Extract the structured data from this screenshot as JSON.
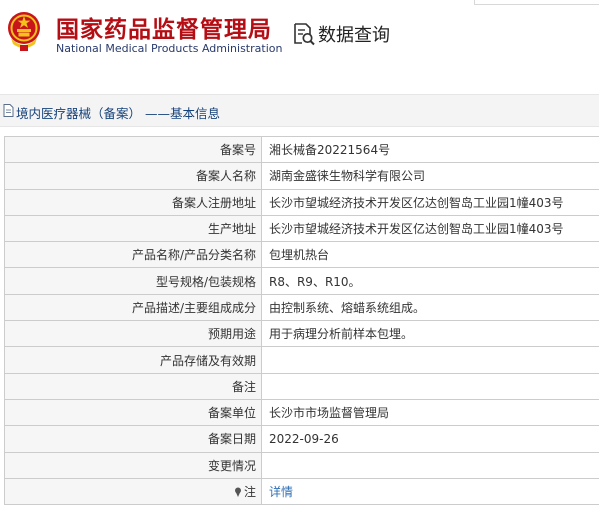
{
  "header": {
    "title_cn": "国家药品监督管理局",
    "title_en": "National Medical Products Administration",
    "query_label": "数据查询"
  },
  "section": {
    "title": "境内医疗器械（备案） ——基本信息"
  },
  "icons": {
    "emblem": "national-emblem-icon",
    "query": "document-search-icon",
    "section": "document-icon",
    "note": "pin-icon"
  },
  "colors": {
    "title": "#b40e14",
    "link": "#2f6fb5",
    "section_title": "#15417a"
  },
  "rows": [
    {
      "label": "备案号",
      "value": "湘长械备20221564号"
    },
    {
      "label": "备案人名称",
      "value": "湖南金盛徕生物科学有限公司"
    },
    {
      "label": "备案人注册地址",
      "value": "长沙市望城经济技术开发区亿达创智岛工业园1幢403号"
    },
    {
      "label": "生产地址",
      "value": "长沙市望城经济技术开发区亿达创智岛工业园1幢403号"
    },
    {
      "label": "产品名称/产品分类名称",
      "value": "包埋机热台"
    },
    {
      "label": "型号规格/包装规格",
      "value": "R8、R9、R10。"
    },
    {
      "label": "产品描述/主要组成成分",
      "value": "由控制系统、熔蜡系统组成。"
    },
    {
      "label": "预期用途",
      "value": "用于病理分析前样本包埋。"
    },
    {
      "label": "产品存储及有效期",
      "value": ""
    },
    {
      "label": "备注",
      "value": ""
    },
    {
      "label": "备案单位",
      "value": "长沙市市场监督管理局"
    },
    {
      "label": "备案日期",
      "value": "2022-09-26"
    },
    {
      "label": "变更情况",
      "value": ""
    },
    {
      "label": "注",
      "value": "详情"
    }
  ]
}
